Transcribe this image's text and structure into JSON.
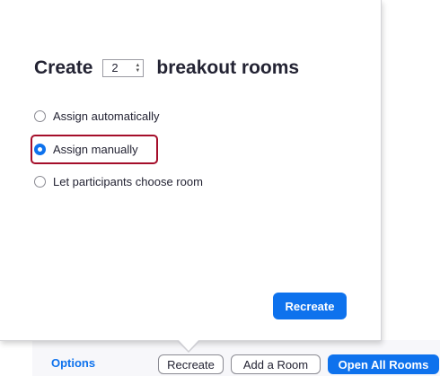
{
  "dialog": {
    "title_prefix": "Create",
    "room_count": "2",
    "title_suffix": "breakout rooms",
    "options": [
      {
        "label": "Assign automatically",
        "selected": false
      },
      {
        "label": "Assign manually",
        "selected": true
      },
      {
        "label": "Let participants choose room",
        "selected": false
      }
    ],
    "recreate_label": "Recreate"
  },
  "bottom_bar": {
    "options_label": "Options",
    "recreate_label": "Recreate",
    "add_room_label": "Add a Room",
    "open_all_label": "Open All Rooms"
  },
  "colors": {
    "accent": "#0e72ed",
    "highlight": "#a50e2a"
  }
}
